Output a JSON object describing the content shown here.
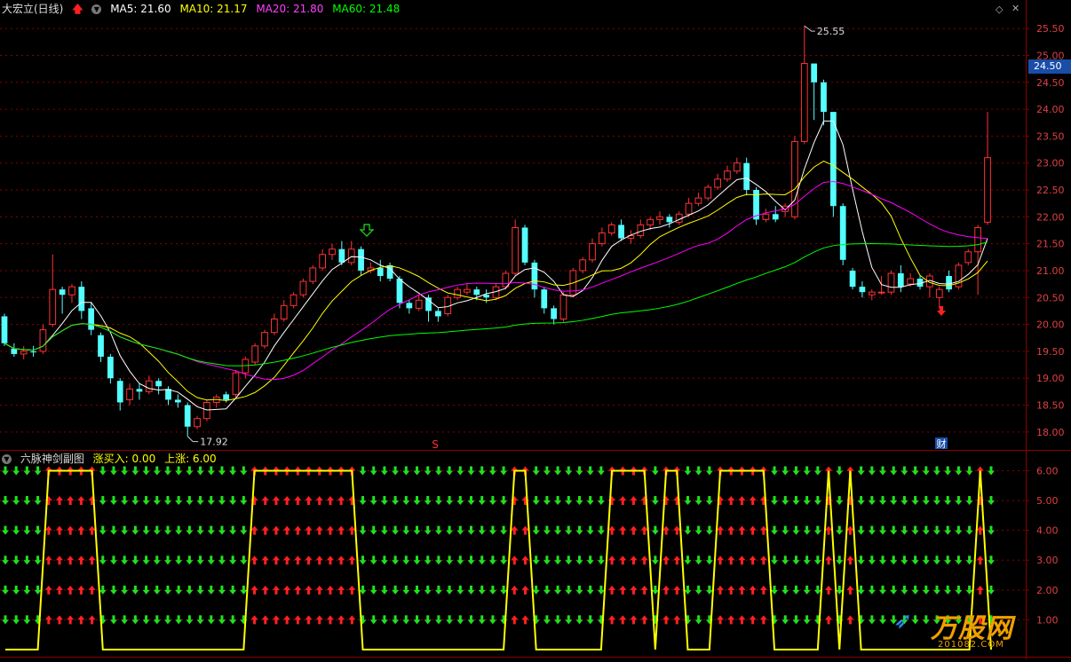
{
  "header": {
    "stock_name": "大宏立(日线)",
    "ma5_label": "MA5: 21.60",
    "ma10_label": "MA10: 21.17",
    "ma20_label": "MA20: 21.80",
    "ma60_label": "MA60: 21.48"
  },
  "sub_header": {
    "indicator_name": "六脉神剑副图",
    "buy_label": "涨买入: 0.00",
    "up_label": "上涨: 6.00"
  },
  "price_badge": "24.50",
  "watermark": {
    "brand": "万股网",
    "url": "201082.COM"
  },
  "colors": {
    "up": "#ff3232",
    "down": "#54ffff",
    "ma5": "#ffffff",
    "ma10": "#ffff00",
    "ma20": "#ff00ff",
    "ma60": "#00ff00",
    "grid": "#8b0000",
    "indicator": "#ffff00",
    "arrow_up": "#ff2020",
    "arrow_down": "#20e020"
  },
  "chart_data": {
    "type": "candlestick",
    "y_range": [
      17.7,
      25.75
    ],
    "y_ticks": [
      "18.00",
      "18.50",
      "19.00",
      "19.50",
      "20.00",
      "20.50",
      "21.00",
      "21.50",
      "22.00",
      "22.50",
      "23.00",
      "23.50",
      "24.00",
      "24.50",
      "25.00",
      "25.50"
    ],
    "annotations": {
      "high": "25.55",
      "low": "17.92"
    },
    "markers": {
      "s_label": "S",
      "cai_label": "财"
    },
    "candles": [
      [
        20.15,
        19.65,
        20.2,
        19.6
      ],
      [
        19.55,
        19.45,
        19.65,
        19.4
      ],
      [
        19.45,
        19.5,
        19.6,
        19.35
      ],
      [
        19.5,
        19.48,
        19.6,
        19.4
      ],
      [
        19.5,
        19.9,
        20.0,
        19.45
      ],
      [
        20.0,
        20.65,
        21.3,
        19.95
      ],
      [
        20.65,
        20.55,
        20.7,
        20.2
      ],
      [
        20.55,
        20.7,
        20.75,
        20.4
      ],
      [
        20.7,
        20.25,
        20.8,
        20.1
      ],
      [
        20.3,
        19.9,
        20.4,
        19.8
      ],
      [
        19.8,
        19.4,
        19.85,
        19.3
      ],
      [
        19.4,
        19.0,
        19.45,
        18.9
      ],
      [
        18.95,
        18.55,
        19.0,
        18.4
      ],
      [
        18.6,
        18.8,
        18.9,
        18.5
      ],
      [
        18.8,
        18.75,
        18.9,
        18.6
      ],
      [
        18.75,
        18.95,
        19.05,
        18.7
      ],
      [
        18.95,
        18.85,
        19.0,
        18.7
      ],
      [
        18.8,
        18.6,
        18.85,
        18.5
      ],
      [
        18.6,
        18.55,
        18.7,
        18.45
      ],
      [
        18.5,
        18.1,
        18.55,
        17.92
      ],
      [
        18.1,
        18.25,
        18.3,
        18.05
      ],
      [
        18.25,
        18.55,
        18.6,
        18.2
      ],
      [
        18.55,
        18.65,
        18.7,
        18.45
      ],
      [
        18.7,
        18.6,
        18.75,
        18.55
      ],
      [
        18.7,
        19.1,
        19.15,
        18.65
      ],
      [
        19.1,
        19.35,
        19.4,
        19.0
      ],
      [
        19.3,
        19.6,
        19.65,
        19.25
      ],
      [
        19.6,
        19.85,
        19.9,
        19.55
      ],
      [
        19.85,
        20.1,
        20.2,
        19.8
      ],
      [
        20.1,
        20.35,
        20.45,
        20.05
      ],
      [
        20.35,
        20.55,
        20.6,
        20.3
      ],
      [
        20.55,
        20.8,
        20.85,
        20.5
      ],
      [
        20.8,
        21.05,
        21.1,
        20.75
      ],
      [
        21.05,
        21.3,
        21.4,
        21.0
      ],
      [
        21.3,
        21.4,
        21.5,
        21.2
      ],
      [
        21.4,
        21.15,
        21.55,
        21.1
      ],
      [
        21.15,
        21.4,
        21.55,
        21.1
      ],
      [
        21.4,
        21.0,
        21.45,
        20.9
      ],
      [
        21.0,
        21.05,
        21.15,
        20.95
      ],
      [
        21.05,
        20.9,
        21.2,
        20.8
      ],
      [
        21.1,
        20.85,
        21.15,
        20.8
      ],
      [
        20.85,
        20.4,
        20.9,
        20.3
      ],
      [
        20.4,
        20.3,
        20.45,
        20.2
      ],
      [
        20.3,
        20.45,
        20.55,
        20.25
      ],
      [
        20.5,
        20.25,
        20.55,
        20.05
      ],
      [
        20.25,
        20.15,
        20.3,
        20.05
      ],
      [
        20.2,
        20.5,
        20.55,
        20.15
      ],
      [
        20.5,
        20.65,
        20.7,
        20.45
      ],
      [
        20.6,
        20.65,
        20.75,
        20.55
      ],
      [
        20.65,
        20.55,
        20.7,
        20.45
      ],
      [
        20.55,
        20.5,
        20.65,
        20.4
      ],
      [
        20.5,
        20.7,
        20.75,
        20.45
      ],
      [
        20.7,
        20.95,
        21.0,
        20.65
      ],
      [
        20.95,
        21.8,
        21.95,
        20.9
      ],
      [
        21.8,
        21.15,
        21.85,
        21.1
      ],
      [
        21.15,
        20.65,
        21.2,
        20.5
      ],
      [
        20.65,
        20.3,
        20.7,
        20.2
      ],
      [
        20.3,
        20.1,
        20.35,
        20.0
      ],
      [
        20.1,
        20.55,
        20.6,
        20.05
      ],
      [
        20.55,
        21.0,
        21.05,
        20.5
      ],
      [
        21.0,
        21.2,
        21.25,
        20.95
      ],
      [
        21.2,
        21.5,
        21.6,
        21.15
      ],
      [
        21.5,
        21.7,
        21.8,
        21.45
      ],
      [
        21.7,
        21.85,
        21.9,
        21.65
      ],
      [
        21.85,
        21.6,
        21.95,
        21.55
      ],
      [
        21.6,
        21.65,
        21.75,
        21.5
      ],
      [
        21.65,
        21.85,
        21.95,
        21.6
      ],
      [
        21.85,
        21.95,
        22.0,
        21.75
      ],
      [
        21.95,
        22.0,
        22.1,
        21.85
      ],
      [
        22.0,
        21.9,
        22.05,
        21.8
      ],
      [
        21.9,
        22.05,
        22.1,
        21.85
      ],
      [
        22.05,
        22.25,
        22.35,
        22.0
      ],
      [
        22.25,
        22.35,
        22.45,
        22.2
      ],
      [
        22.35,
        22.55,
        22.6,
        22.3
      ],
      [
        22.55,
        22.7,
        22.8,
        22.5
      ],
      [
        22.7,
        22.85,
        22.95,
        22.65
      ],
      [
        22.85,
        23.0,
        23.1,
        22.8
      ],
      [
        23.0,
        22.5,
        23.1,
        22.4
      ],
      [
        22.5,
        21.95,
        22.55,
        21.85
      ],
      [
        21.95,
        22.05,
        22.15,
        21.9
      ],
      [
        22.05,
        21.95,
        22.2,
        21.9
      ],
      [
        22.1,
        22.2,
        22.25,
        22.0
      ],
      [
        22.0,
        23.4,
        23.5,
        21.95
      ],
      [
        23.4,
        24.85,
        25.55,
        23.35
      ],
      [
        24.85,
        24.5,
        24.85,
        23.8
      ],
      [
        24.5,
        23.95,
        24.55,
        23.7
      ],
      [
        23.95,
        22.2,
        23.95,
        22.0
      ],
      [
        22.2,
        21.2,
        22.25,
        21.1
      ],
      [
        21.0,
        20.7,
        21.05,
        20.65
      ],
      [
        20.7,
        20.6,
        20.8,
        20.5
      ],
      [
        20.55,
        20.6,
        20.65,
        20.45
      ],
      [
        20.6,
        20.6,
        20.9,
        20.55
      ],
      [
        20.6,
        20.95,
        21.0,
        20.55
      ],
      [
        20.95,
        20.7,
        21.1,
        20.6
      ],
      [
        20.75,
        20.85,
        20.95,
        20.7
      ],
      [
        20.85,
        20.7,
        20.9,
        20.65
      ],
      [
        20.7,
        20.9,
        20.95,
        20.5
      ],
      [
        20.5,
        20.65,
        20.7,
        20.3
      ],
      [
        20.9,
        20.65,
        21.0,
        20.6
      ],
      [
        20.7,
        21.1,
        21.15,
        20.65
      ],
      [
        21.15,
        21.35,
        21.4,
        21.1
      ],
      [
        21.35,
        21.8,
        21.85,
        20.55
      ],
      [
        21.9,
        23.1,
        23.95,
        21.85
      ]
    ],
    "indicator": {
      "y_range": [
        0,
        6.4
      ],
      "y_ticks": [
        "1.00",
        "2.00",
        "3.00",
        "4.00",
        "5.00",
        "6.00"
      ],
      "values": [
        0,
        0,
        0,
        0,
        6,
        6,
        6,
        6,
        6,
        0,
        0,
        0,
        0,
        0,
        0,
        0,
        0,
        0,
        0,
        0,
        0,
        0,
        0,
        6,
        6,
        6,
        6,
        6,
        6,
        6,
        6,
        6,
        6,
        0,
        0,
        0,
        0,
        0,
        0,
        0,
        0,
        0,
        0,
        0,
        0,
        0,
        0,
        6,
        6,
        0,
        0,
        0,
        0,
        0,
        0,
        0,
        6,
        6,
        6,
        6,
        0,
        6,
        6,
        0,
        0,
        0,
        6,
        6,
        6,
        6,
        6,
        0,
        0,
        0,
        0,
        0,
        6,
        0,
        6,
        0,
        0,
        0,
        0,
        0,
        0,
        0,
        0,
        0,
        0,
        0,
        6,
        0
      ]
    }
  }
}
